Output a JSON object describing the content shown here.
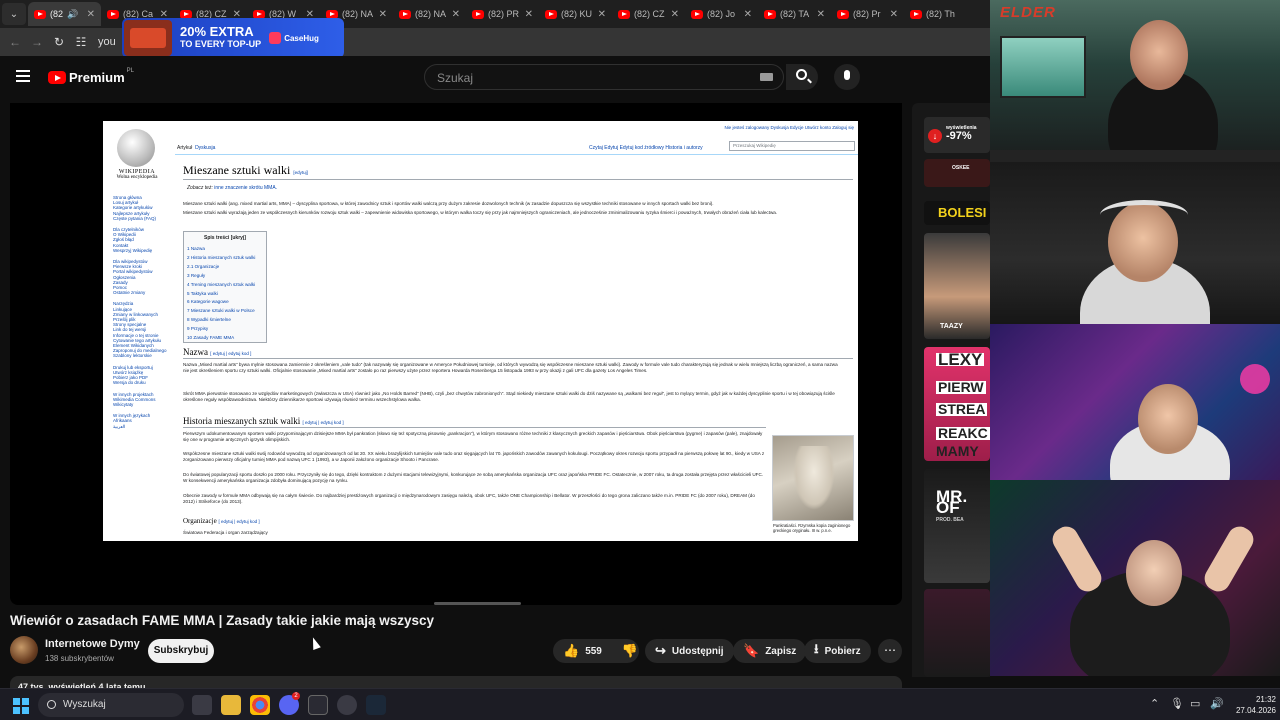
{
  "browser": {
    "tabs": [
      {
        "label": "(82",
        "active": true
      },
      {
        "label": "(82) Ca"
      },
      {
        "label": "(82) CZ"
      },
      {
        "label": "(82) W"
      },
      {
        "label": "(82) NA"
      },
      {
        "label": "(82) NA"
      },
      {
        "label": "(82) PR"
      },
      {
        "label": "(82) KU"
      },
      {
        "label": "(82) CZ"
      },
      {
        "label": "(82) Jo"
      },
      {
        "label": "(82) TA"
      },
      {
        "label": "(82) Pr"
      },
      {
        "label": "(82) Th"
      }
    ],
    "url": "you",
    "ad": {
      "line1": "20% EXTRA",
      "line2": "TO EVERY TOP-UP",
      "brand": "CaseHug"
    }
  },
  "youtube": {
    "brand": "Premium",
    "region": "PL",
    "search_placeholder": "Szukaj",
    "video_title": "Wiewiór o zasadach FAME MMA | Zasady takie jakie mają wszyscy",
    "channel_name": "Internetowe Dymy",
    "channel_subs": "138 subskrybentów",
    "subscribe_label": "Subskrybuj",
    "likes": "559",
    "share_label": "Udostępnij",
    "save_label": "Zapisz",
    "download_label": "Pobierz",
    "views_line": "47 tys. wyświetleń  4 lata temu"
  },
  "wiki": {
    "wordmark_1": "WIKIPEDIA",
    "wordmark_2": "Wolna encyklopedia",
    "tab_article": "Artykuł",
    "tab_discussion": "Dyskusja",
    "tabs_right": "Czytaj   Edytuj   Edytuj kod źródłowy   Historia i autorzy",
    "user_links": "Nie jesteś zalogowany  Dyskusja  Edycje  Utwórz konto  Zaloguj się",
    "search_placeholder": "Przeszukaj Wikipedię",
    "title": "Mieszane sztuki walki",
    "edit_small": "[edytuj]",
    "hatnote_prefix": "Zobacz też: ",
    "hatnote_link": "inne znaczenie skrótu MMA.",
    "sidebar": [
      "Strona główna",
      "Losuj artykuł",
      "Kategorie artykułów",
      "Najlepsze artykuły",
      "Częste pytania (FAQ)",
      "",
      "Dla czytelników",
      "O Wikipedii",
      "Zgłoś błąd",
      "Kontakt",
      "Wesprzyj Wikipedię",
      "",
      "Dla wikipedystów",
      "Pierwsze kroki",
      "Portal wikipedystów",
      "Ogłoszenia",
      "Zasady",
      "Pomoc",
      "Ostatnie zmiany",
      "",
      "Narzędzia",
      "Linkujące",
      "Zmiany w linkowanych",
      "Prześlij plik",
      "Strony specjalne",
      "Link do tej wersji",
      "Informacje o tej stronie",
      "Cytowanie tego artykułu",
      "Element Wikidanych",
      "Zaproponuj do medialnego",
      "Szablony lektorskie",
      "",
      "Drukuj lub eksportuj",
      "Utwórz książkę",
      "Pobierz jako PDF",
      "Wersja do druku",
      "",
      "W innych projektach",
      "Wikimedia Commons",
      "Wikicytaty",
      "",
      "W innych językach",
      "Afrikaans",
      "العربية"
    ],
    "lead_1": "Mieszane sztuki walki (ang. mixed martial arts, MMA) – dyscyplina sportowa, w której zawodnicy sztuk i sportów walki walczą przy dużym zakresie dozwolonych technik (w zasadzie dopuszcza się wszystkie techniki stosowane w innych sportach walki bez broni).",
    "lead_2": "Mieszane sztuki walki wyrażają jeden ze współczesnych kierunków rozwoju sztuk walki – zapewnienie widowiska sportowego, w którym walka toczy się przy jak najmniejszych ograniczeniach, ale jednocześnie zminimalizowaniu ryzyka śmierci i poważnych, trwałych obrażeń ciała lub kalectwa.",
    "toc_title": "Spis treści [ukryj]",
    "toc": [
      "1  Nazwa",
      "2  Historia mieszanych sztuk walki",
      "   2.1  Organizacje",
      "3  Reguły",
      "4  Trening mieszanych sztuk walki",
      "5  Taktyka walki",
      "6  Kategorie wagowe",
      "7  Mieszane sztuki walki w Polsce",
      "8  Wypadki śmiertelne",
      "9  Przypisy",
      "10 Zasady FAME MMA"
    ],
    "h_nazwa": "Nazwa",
    "h_edit": "[ edytuj | edytuj kod ]",
    "nazwa_1": "Nazwa „Mixed martial arts” bywa mylnie stosowana zamiennie z określeniem „vale tudo” (tak nazywały się organizowane w Ameryce Południowej turnieje, od których wywodzą się współczesne mieszane sztuki walki). Zawody w formule vale tudo charakteryzują się jednak w wielu mniejszą liczbą ograniczeń, a sama nazwa nie jest określeniem sportu czy sztuki walki. Oficjalnie stosowanie „Mixed martial arts” zostało po raz pierwszy użyte przez reportera Howarda Rosenberga 15 listopada 1993 w przy okazji z gali UFC dla gazety Los Angeles Times.",
    "nazwa_2": "Skrót MMA pierwotnie stosowano ze względów marketingowych (zwłaszcza w USA) również jako „No Holds Barred” (NHB), czyli „bez chwytów zabronionych”. Stąd niekiedy mieszane sztuki walki do dziś nazywane są „walkami bez reguł”, jest to mylący termin, gdyż jak w każdej dyscyplinie sportu i w tej obowiązują ściśle określone reguły współzawodnictwa. Niektórzy dziennikarze sportowi używają również terminu wszechstylowa walka.",
    "h_historia": "Historia mieszanych sztuk walki",
    "hist_1": "Pierwszym udokumentowanym sportem walki przypominającym dzisiejsze MMA był pankration (słowo się też spotyczną pisownię „pankracjon”), w którym stosowano różne techniki z klasycznych greckich zapasów i pięściarstwa. Obok pięściarstwa (pygme) i zapasów (pale), znajdowały się one w programie antycznych igrzysk olimpijskich.",
    "hist_2": "Współczesne mieszane sztuki walki swój rodowód wywodzą od organizowanych od lat 20. XX wieku brazylijskich turniejów vale tudo oraz sięgających lat 70. japońskich zawodów zawanych kokulougi. Początkowy okres rozwoju sportu przypadł na pierwszą połowę lat 90., kiedy w USA z zorganizowano pierwszy oficjalny turniej MMA pod nazwą UFC 1 (1993), a w Japonii założono organizacje Shooto i Pancrase.",
    "hist_3": "Do światowej popularyzacji sportu doszło po 2000 roku. Przyczyniły się do tego, dzięki kontraktom z dużymi stacjami telewizyjnymi, konkurujące ze sobą amerykańska organizacja UFC oraz japońska PRIDE FC. Ostatecznie, w 2007 roku, ta druga została przejęta przez właścicieli UFC. W konsekwencji amerykańska organizacja zdobyła dominującą pozycję na rynku.",
    "hist_4": "Obecnie zawody w formule MMA odbywają się na całym świecie. Do najbardziej prestiżowych organizacji o międzynarodowym zasięgu należą, obok UFC, także ONE Championship i Bellator. W przeszłości do tego grona zaliczano także m.in. PRIDE FC (do 2007 roku), DREAM (do 2012) i Strikeforce (do 2013).",
    "h_org": "Organizacje",
    "org_1": "Światowa Federacja i organ zarządzający",
    "caption": "Pankratiaści. Rzymska kopia zaginionego greckiego oryginału. III w. p.n.e."
  },
  "side_tiles": {
    "t1_label": "wyświetlenia",
    "t1_value": "-97%",
    "t2_label": "OSKEE",
    "t3": "BOLESI",
    "t4": "TAAZY",
    "t5": "LEXY",
    "t6a": "PIERW",
    "t6b": "STREA",
    "t7a": "REAKC",
    "t7b": "MAMY",
    "t8a": "MR. OF",
    "t8b": "PROD. BEA"
  },
  "stream_overlay": {
    "logo": "ELDER"
  },
  "taskbar": {
    "search_label": "Wyszukaj",
    "time": "21:32",
    "date": "27.04.2026",
    "badge": "2"
  }
}
